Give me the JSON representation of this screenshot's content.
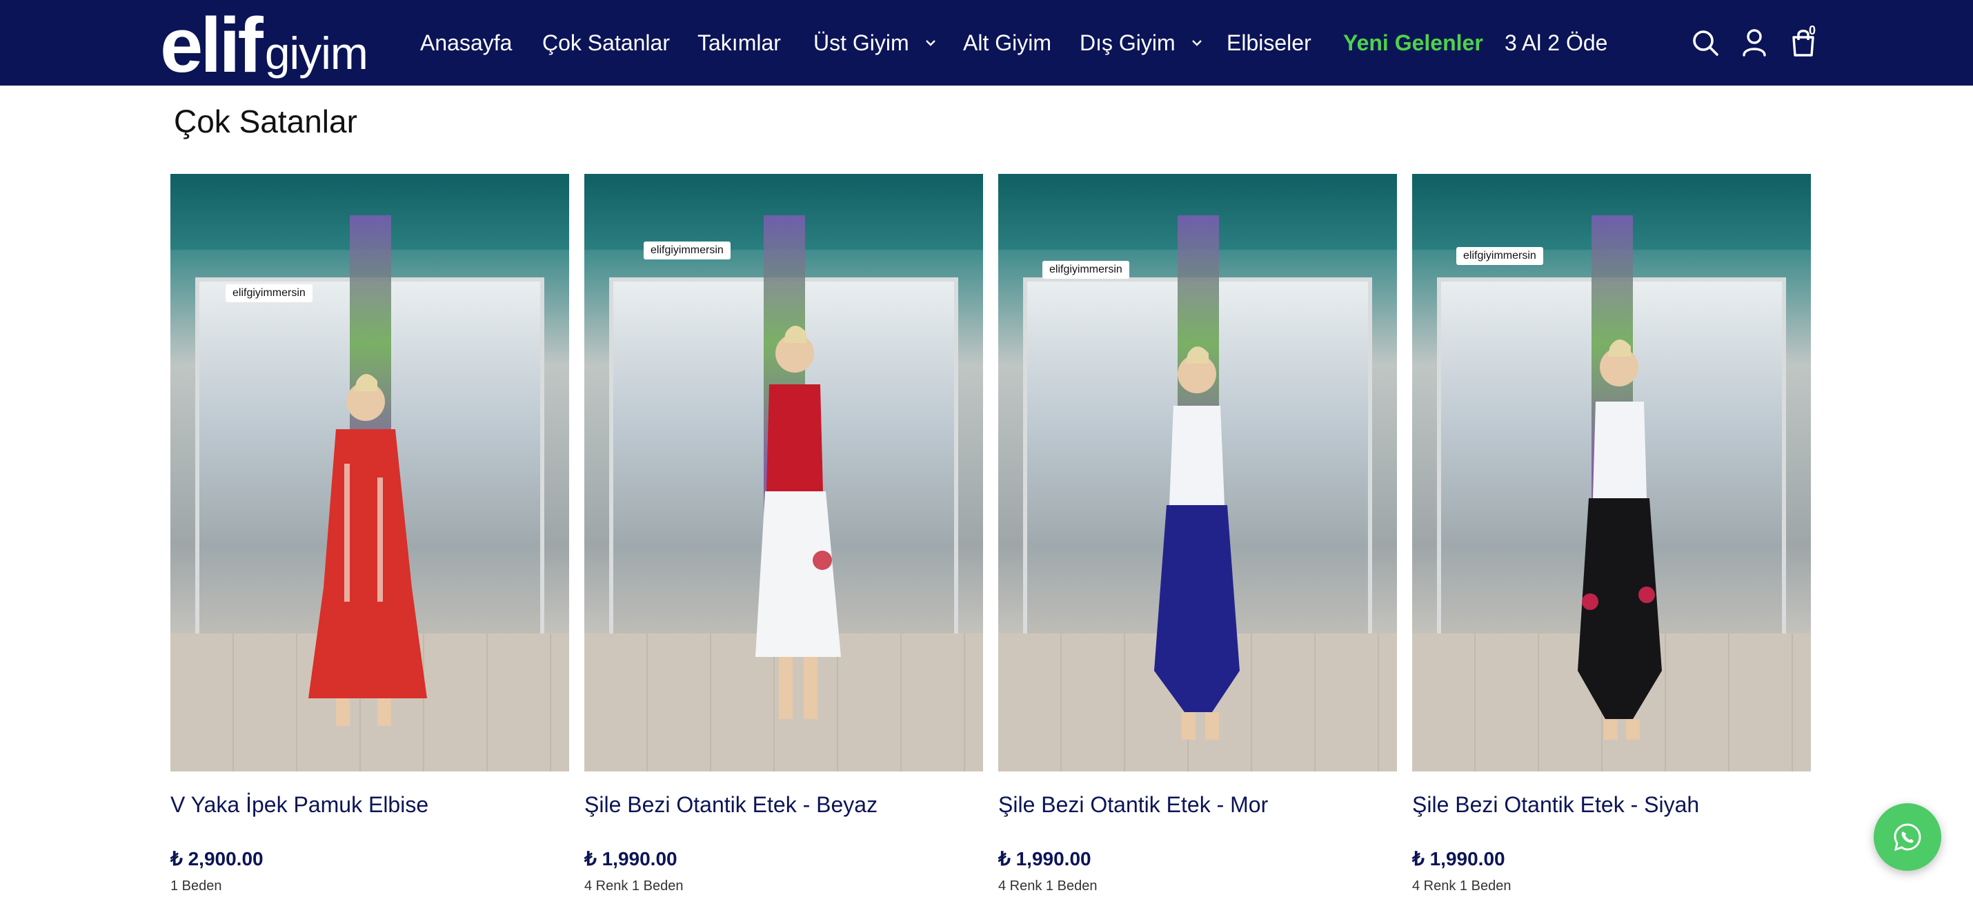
{
  "brand": {
    "main": "elif",
    "sub": "giyim"
  },
  "nav": {
    "items": [
      {
        "label": "Anasayfa"
      },
      {
        "label": "Çok Satanlar"
      },
      {
        "label": "Takımlar"
      },
      {
        "label": "Üst Giyim",
        "has_dropdown": true
      },
      {
        "label": "Alt Giyim"
      },
      {
        "label": "Dış Giyim",
        "has_dropdown": true
      },
      {
        "label": "Elbiseler"
      },
      {
        "label": "Yeni Gelenler",
        "active": true
      },
      {
        "label": "3 Al 2 Öde"
      }
    ],
    "icons": [
      "search-icon",
      "account-icon",
      "cart-icon"
    ],
    "cart_count": "0"
  },
  "section": {
    "title": "Çok Satanlar"
  },
  "products": [
    {
      "title": "V Yaka İpek Pamuk Elbise",
      "price": "₺ 2,900.00",
      "variants": "1 Beden",
      "outfit": "red-dress",
      "instagram_tag": "elifgiyimmersin"
    },
    {
      "title": "Şile Bezi Otantik Etek - Beyaz",
      "price": "₺ 1,990.00",
      "variants": "4 Renk 1 Beden",
      "outfit": "red-top-white-skirt",
      "instagram_tag": "elifgiyimmersin"
    },
    {
      "title": "Şile Bezi Otantik Etek - Mor",
      "price": "₺ 1,990.00",
      "variants": "4 Renk 1 Beden",
      "outfit": "white-top-purple-skirt",
      "instagram_tag": "elifgiyimmersin"
    },
    {
      "title": "Şile Bezi Otantik Etek - Siyah",
      "price": "₺ 1,990.00",
      "variants": "4 Renk 1 Beden",
      "outfit": "white-top-black-skirt",
      "instagram_tag": "elifgiyimmersin"
    }
  ],
  "colors": {
    "header_bg": "#0b1456",
    "active_nav": "#4ed24b",
    "text_primary": "#0b1456",
    "whatsapp": "#4ccb66"
  },
  "floating": {
    "icon": "whatsapp-icon"
  }
}
